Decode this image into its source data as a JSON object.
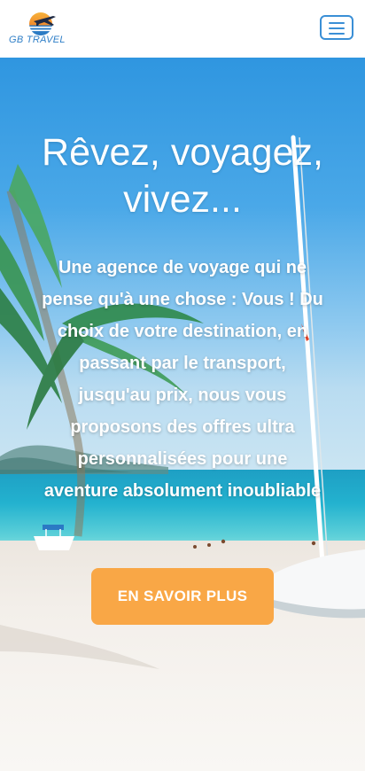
{
  "brand": {
    "name": "GB TRAVEL",
    "text_color": "#2f7fc7"
  },
  "navbar": {
    "menu_icon": "hamburger-menu-icon",
    "menu_accent": "#3a8fd6"
  },
  "hero": {
    "title": "Rêvez, voyagez, vivez...",
    "description": "Une agence de voyage qui ne pense qu'à une chose : Vous ! Du choix de votre destination, en passant par le transport, jusqu'au prix, nous vous proposons des offres ultra personnalisées pour une aventure absolument inoubliable",
    "cta_label": "EN SAVOIR PLUS",
    "cta_color": "#f9a746"
  }
}
